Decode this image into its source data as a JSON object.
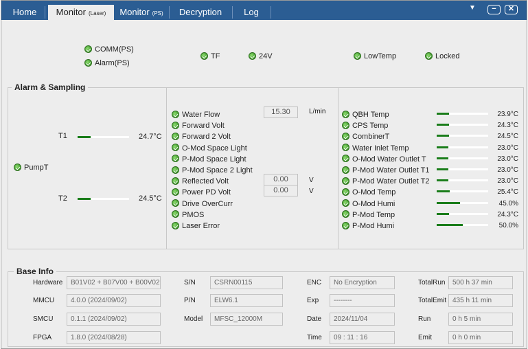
{
  "tabs": [
    {
      "label": "Home",
      "suffix": ""
    },
    {
      "label": "Monitor",
      "suffix": "(Laser)"
    },
    {
      "label": "Monitor",
      "suffix": "(PS)"
    },
    {
      "label": "Decryption",
      "suffix": ""
    },
    {
      "label": "Log",
      "suffix": ""
    }
  ],
  "window": {
    "menu_icon": "▼",
    "minimize": "−",
    "close": "✕"
  },
  "top_indicators": {
    "comm": "COMM(PS)",
    "alarm": "Alarm(PS)",
    "tf": "TF",
    "v24": "24V",
    "lowtemp": "LowTemp",
    "locked": "Locked"
  },
  "alarm_sampling": {
    "title": "Alarm & Sampling",
    "pump": "PumpT",
    "t1": {
      "label": "T1",
      "value": "24.7°C",
      "level": 0.25
    },
    "t2": {
      "label": "T2",
      "value": "24.5°C",
      "level": 0.25
    },
    "middle": [
      "Water Flow",
      "Forward Volt",
      "Forward 2 Volt",
      "O-Mod Space Light",
      "P-Mod Space Light",
      "P-Mod Space 2 Light",
      "Reflected Volt",
      "Power PD Volt",
      "Drive OverCurr",
      "PMOS",
      "Laser Error"
    ],
    "water_flow": {
      "value": "15.30",
      "unit": "L/min"
    },
    "reflected_volt": {
      "value": "0.00",
      "unit": "V"
    },
    "power_pd_volt": {
      "value": "0.00",
      "unit": "V"
    },
    "right": [
      {
        "label": "QBH Temp",
        "value": "23.9°C",
        "level": 0.24
      },
      {
        "label": "CPS Temp",
        "value": "24.3°C",
        "level": 0.24
      },
      {
        "label": "CombinerT",
        "value": "24.5°C",
        "level": 0.24
      },
      {
        "label": "Water Inlet Temp",
        "value": "23.0°C",
        "level": 0.23
      },
      {
        "label": "O-Mod Water Outlet T",
        "value": "23.0°C",
        "level": 0.23
      },
      {
        "label": "P-Mod Water Outlet T1",
        "value": "23.0°C",
        "level": 0.23
      },
      {
        "label": "P-Mod Water Outlet T2",
        "value": "23.0°C",
        "level": 0.23
      },
      {
        "label": "O-Mod Temp",
        "value": "25.4°C",
        "level": 0.25
      },
      {
        "label": "O-Mod Humi",
        "value": "45.0%",
        "level": 0.45
      },
      {
        "label": "P-Mod Temp",
        "value": "24.3°C",
        "level": 0.24
      },
      {
        "label": "P-Mod Humi",
        "value": "50.0%",
        "level": 0.5
      }
    ]
  },
  "base_info": {
    "title": "Base Info",
    "col1": [
      {
        "label": "Hardware",
        "value": "B01V02 + B07V00 + B00V02"
      },
      {
        "label": "MMCU",
        "value": "4.0.0 (2024/09/02)"
      },
      {
        "label": "SMCU",
        "value": "0.1.1 (2024/09/02)"
      },
      {
        "label": "FPGA",
        "value": "1.8.0 (2024/08/28)"
      }
    ],
    "col2": [
      {
        "label": "S/N",
        "value": "CSRN00115"
      },
      {
        "label": "P/N",
        "value": "ELW6.1"
      },
      {
        "label": "Model",
        "value": "MFSC_12000M"
      }
    ],
    "col3": [
      {
        "label": "ENC",
        "value": "No Encryption"
      },
      {
        "label": "Exp",
        "value": "--------"
      },
      {
        "label": "Date",
        "value": "2024/11/04"
      },
      {
        "label": "Time",
        "value": "09 : 11 : 16"
      }
    ],
    "col4": [
      {
        "label": "TotalRun",
        "value": "500 h 37 min"
      },
      {
        "label": "TotalEmit",
        "value": "435 h 11 min"
      },
      {
        "label": "Run",
        "value": "0 h 5 min"
      },
      {
        "label": "Emit",
        "value": "0 h 0 min"
      }
    ]
  }
}
